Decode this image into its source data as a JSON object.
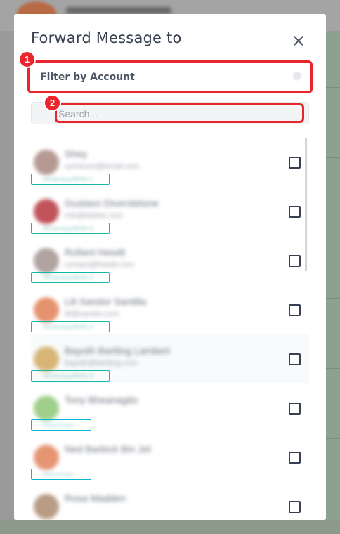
{
  "modal": {
    "title": "Forward Message to",
    "filter_label": "Filter by Account",
    "search_placeholder": "Search...",
    "annotations": [
      "1",
      "2"
    ]
  },
  "contacts": [
    {
      "name": "Shey",
      "detail": "someone@email.com",
      "tag": "WhatsApp/BMN-1",
      "avatar_color": "#b59a93",
      "tag_style": "teal"
    },
    {
      "name": "Gustavo Diverstelone",
      "detail": "info@delete.com",
      "tag": "WhatsApp/BMN-2",
      "avatar_color": "#c0545a",
      "tag_style": "teal"
    },
    {
      "name": "Rollant Hewitt",
      "detail": "contact@hewitt.com",
      "tag": "WhatsApp/BMN-3",
      "avatar_color": "#b0a3a0",
      "tag_style": "teal"
    },
    {
      "name": "Lili Sandor Santilla",
      "detail": "lili@sandor.com",
      "tag": "WhatsApp/BMN-4",
      "avatar_color": "#e6926e",
      "tag_style": "teal"
    },
    {
      "name": "Bayoth Bartling Lambert",
      "detail": "bayoth@bartling.com",
      "tag": "WhatsApp/BMN-5",
      "avatar_color": "#d8b577",
      "tag_style": "teal"
    },
    {
      "name": "Tony Bheanagito",
      "detail": "",
      "tag": "Messenger",
      "avatar_color": "#9fcf8b",
      "tag_style": "blue"
    },
    {
      "name": "Ned Barbick Bin Jet",
      "detail": "",
      "tag": "Messenger",
      "avatar_color": "#e69573",
      "tag_style": "blue"
    },
    {
      "name": "Rosa Madden",
      "detail": "",
      "tag": "",
      "avatar_color": "#b89c85",
      "tag_style": "teal"
    }
  ]
}
